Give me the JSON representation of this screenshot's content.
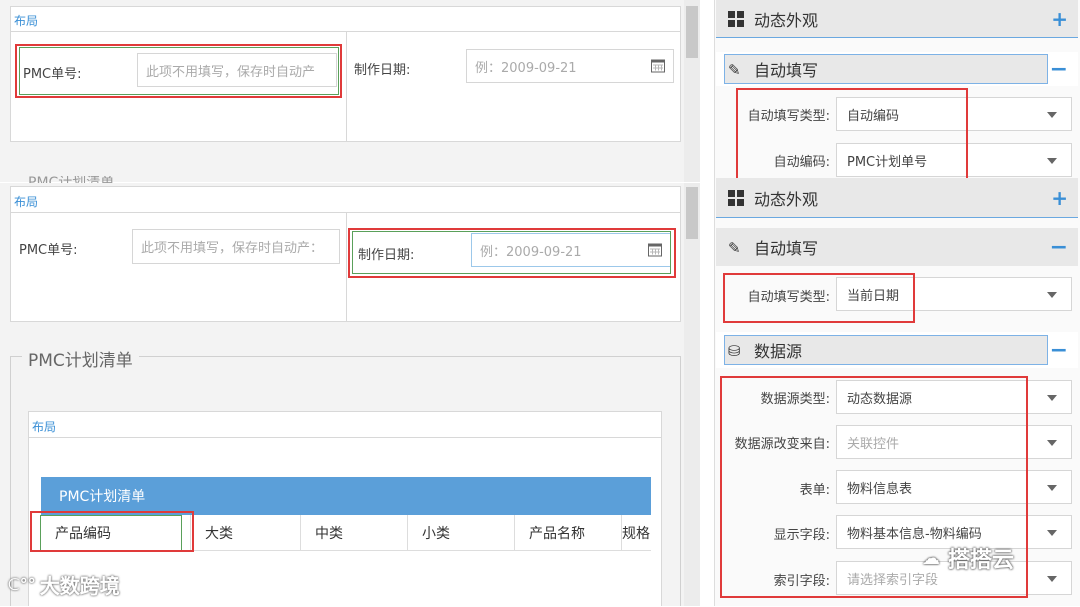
{
  "top": {
    "layout_tag": "布局",
    "pmc_no_label": "PMC单号:",
    "pmc_no_placeholder": "此项不用填写，保存时自动产",
    "date_label": "制作日期:",
    "date_placeholder": "例：2009-09-21",
    "cut_title": "PMC计划清单"
  },
  "middle": {
    "layout_tag": "布局",
    "pmc_no_label": "PMC单号:",
    "pmc_no_placeholder": "此项不用填写，保存时自动产：",
    "date_label": "制作日期:",
    "date_placeholder": "例：2009-09-21"
  },
  "bottom": {
    "fieldset_title": "PMC计划清单",
    "layout_tag": "布局",
    "grid_title": "PMC计划清单",
    "columns": [
      "产品编码",
      "大类",
      "中类",
      "小类",
      "产品名称",
      "规格"
    ]
  },
  "right": {
    "s1_title": "动态外观",
    "s2_title": "自动填写",
    "s2_rows": [
      {
        "label": "自动填写类型:",
        "value": "自动编码"
      },
      {
        "label": "自动编码:",
        "value": "PMC计划单号"
      }
    ],
    "s3_title": "动态外观",
    "s4_title": "自动填写",
    "s4_rows": [
      {
        "label": "自动填写类型:",
        "value": "当前日期"
      }
    ],
    "s5_title": "数据源",
    "s5_rows": [
      {
        "label": "数据源类型:",
        "value": "动态数据源",
        "placeholder": false
      },
      {
        "label": "数据源改变来自:",
        "value": "关联控件",
        "placeholder": true
      },
      {
        "label": "表单:",
        "value": "物料信息表",
        "placeholder": false
      },
      {
        "label": "显示字段:",
        "value": "物料基本信息-物料编码",
        "placeholder": false
      },
      {
        "label": "索引字段:",
        "value": "请选择索引字段",
        "placeholder": true
      }
    ]
  },
  "watermarks": {
    "left": "大数跨境",
    "right": "搭搭云"
  },
  "colors": {
    "accent": "#3a8fd6",
    "highlight": "#e03a3a",
    "grid_header": "#5b9fd9"
  }
}
